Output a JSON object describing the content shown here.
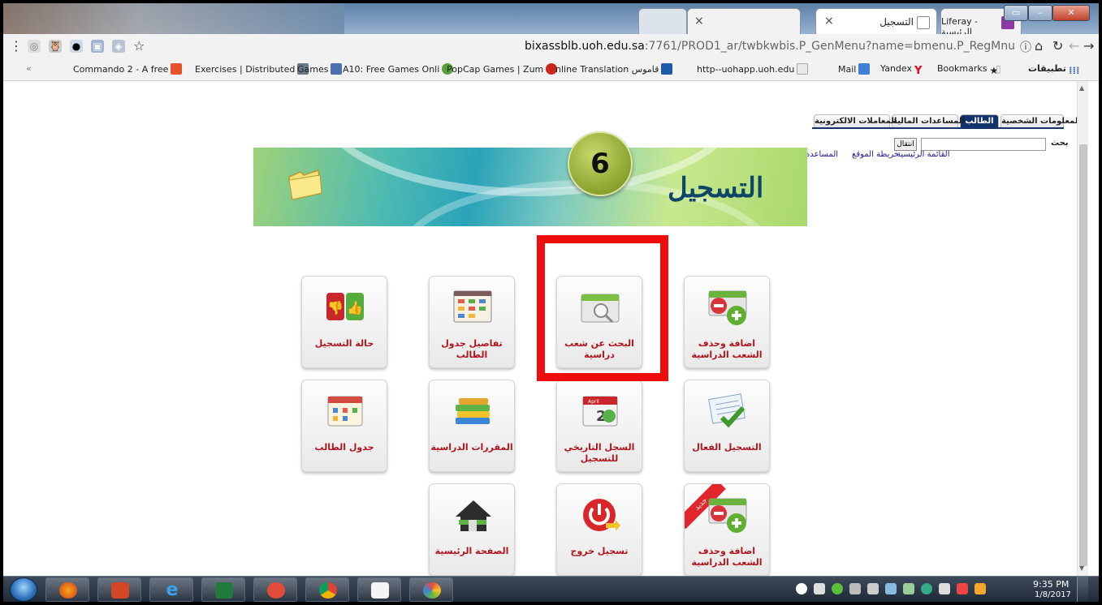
{
  "browser": {
    "tabs": [
      {
        "label": "× ",
        "icon": "blank-tab-icon"
      },
      {
        "label": "التسجيل",
        "icon": "page-icon"
      },
      {
        "label": "Liferay - الرئيسية",
        "icon": "ie-icon"
      }
    ],
    "tab_close": "×",
    "url_host": "bixassblb.uoh.edu.sa",
    "url_path": ":7761/PROD1_ar/twbkwbis.P_GenMenu?name=bmenu.P_RegMnu",
    "bookmarks": [
      "Commando 2 - A free",
      "Exercises | Distributed",
      "Games",
      "A10: Free Games Onli",
      "PopCap Games | Zum",
      "nline Translation قاموس",
      "http--uohapp.uoh.edu",
      "Mail",
      "Yandex",
      "Bookmarks",
      "تطبيقات"
    ],
    "more_chevron": "«"
  },
  "site": {
    "tabs": [
      {
        "label": "المعلومات الشخصية",
        "active": false
      },
      {
        "label": "الطالب",
        "active": true
      },
      {
        "label": "المساعدات المالية",
        "active": false
      },
      {
        "label": "المعاملات الالكترونية",
        "active": false
      }
    ],
    "search_label": "بحث",
    "go_label": "انتقال",
    "links": [
      "القائمة الرئيسية",
      "خريطة الموقع",
      "المساعدة"
    ]
  },
  "banner": {
    "title": "التسجيل",
    "step": "6"
  },
  "tiles": [
    {
      "label": "اضافة وحذف الشعب الدراسية",
      "icon": "add-remove-sections-icon"
    },
    {
      "label": "البحث عن شعب دراسية",
      "icon": "search-sections-icon"
    },
    {
      "label": "تفاصيل جدول الطالب",
      "icon": "schedule-details-icon"
    },
    {
      "label": "حالة التسجيل",
      "icon": "registration-status-icon"
    },
    {
      "label": "التسجيل الفعال",
      "icon": "active-registration-icon"
    },
    {
      "label": "السجل التاريخي للتسجيل",
      "icon": "registration-history-icon"
    },
    {
      "label": "المقررات الدراسية",
      "icon": "courses-icon"
    },
    {
      "label": "جدول الطالب",
      "icon": "student-schedule-icon"
    },
    {
      "label": "اضافة وحذف الشعب الدراسية",
      "icon": "add-remove-sections-new-icon",
      "badge": "جديد"
    },
    {
      "label": "تسجيل خروج",
      "icon": "logout-icon"
    },
    {
      "label": "الصفحة الرئيسية",
      "icon": "home-icon"
    }
  ],
  "taskbar": {
    "time": "9:35 PM",
    "date": "1/8/2017"
  },
  "colors": {
    "highlight": "#ee0d0d",
    "tile_label": "#b0141c",
    "active_tab": "#12336b"
  }
}
